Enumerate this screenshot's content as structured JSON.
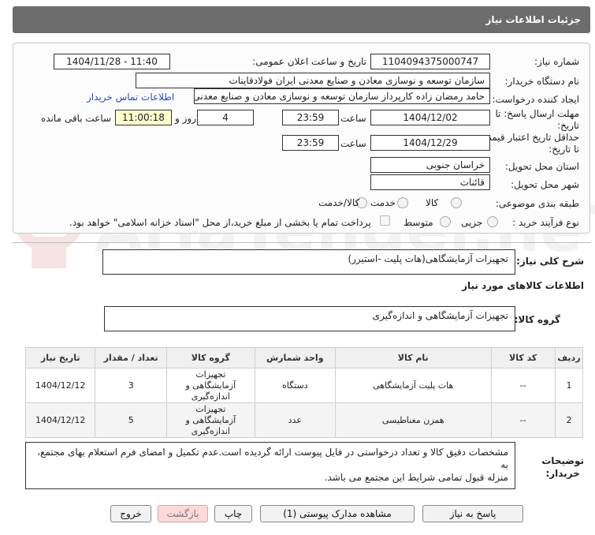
{
  "header": {
    "title": "جزئيات اطلاعات نياز"
  },
  "info": {
    "need_number_label": "شماره نیاز:",
    "need_number": "1104094375000747",
    "announce_label": "تاریخ و ساعت اعلان عمومی:",
    "announce_value": "1404/11/28 - 11:40",
    "buyer_org_label": "نام دستگاه خریدار:",
    "buyer_org": "سازمان توسعه و نوسازی معادن و صنایع معدنی ایران فولادقاپنات",
    "creator_label": "ایجاد کننده درخواست:",
    "creator": "حامد  رمضان زاده  کارپرداز  سازمان توسعه و نوسازی معادن و صنایع معدنی ایران",
    "contact_link": "اطلاعات تماس خریدار",
    "reply_deadline_label": "مهلت ارسال پاسخ: تا تاریخ:",
    "reply_date": "1404/12/02",
    "time_label": "ساعت",
    "reply_time": "23:59",
    "days_value": "4",
    "days_label": "روز و",
    "remaining_time": "11:00:18",
    "remaining_label": "ساعت باقی مانده",
    "validity_label": "حداقل تاریخ اعتبار قیمت: تا تاریخ:",
    "validity_date": "1404/12/29",
    "validity_time": "23:59",
    "province_label": "استان محل تحویل:",
    "province": "خراسان جنوبی",
    "city_label": "شهر محل تحویل:",
    "city": "قائنات",
    "category_label": "طبقه بندی موضوعی:",
    "category_options": [
      "کالا",
      "خدمت",
      "کالا/خدمت"
    ],
    "process_label": "نوع فرآیند خرید :",
    "process_options": [
      "جزیی",
      "متوسط"
    ],
    "process_note": "پرداخت تمام یا بخشی از مبلغ خرید،از محل \"اسناد خزانه اسلامی\" خواهد بود."
  },
  "summary": {
    "label": "شرح کلی نیاز:",
    "value": "تجهیزات آزمایشگاهی(هات پلیت -استیرر)"
  },
  "goods": {
    "section_title": "اطلاعات کالاهای مورد نیاز",
    "group_label": "گروه کالا:",
    "group_value": "تجهیزات آزمایشگاهی و اندازه‌گیری"
  },
  "table": {
    "headers": [
      "ردیف",
      "کد کالا",
      "نام کالا",
      "واحد شمارش",
      "گروه کالا",
      "تعداد / مقدار",
      "تاریخ نیاز"
    ],
    "rows": [
      {
        "idx": "1",
        "code": "--",
        "name": "هات پلیت آزمایشگاهی",
        "unit": "دستگاه",
        "group_l1": "تجهیزات",
        "group_l2": "آزمایشگاهی و",
        "group_l3": "اندازه‌گیری",
        "qty": "3",
        "date": "1404/12/12"
      },
      {
        "idx": "2",
        "code": "--",
        "name": "همزن مغناطیسی",
        "unit": "عدد",
        "group_l1": "تجهیزات",
        "group_l2": "آزمایشگاهی و",
        "group_l3": "اندازه‌گیری",
        "qty": "5",
        "date": "1404/12/12"
      }
    ]
  },
  "notes": {
    "label_l1": "توضیحات",
    "label_l2": "خریدار:",
    "line1": "مشخصات دقیق کالا و تعداد درخواستی در فایل پیوست ارائه گردیده است.عدم تکمیل و امضای فرم استعلام بهای مجتمع، به",
    "line2": "منزله قبول تمامی شرایط این مجتمع می باشد."
  },
  "buttons": {
    "reply": "پاسخ به نیاز",
    "attachments": "مشاهده مدارک پیوستی (1)",
    "print": "چاپ",
    "back": "بازگشت",
    "exit": "خروج"
  },
  "watermark": {
    "text": "AriaTender.neT"
  },
  "colors": {
    "header_bg": "#6c6c6c",
    "link": "#1a4fd6",
    "remaining_bg": "#ffffcc",
    "back_btn_bg": "#ffd9d9"
  }
}
